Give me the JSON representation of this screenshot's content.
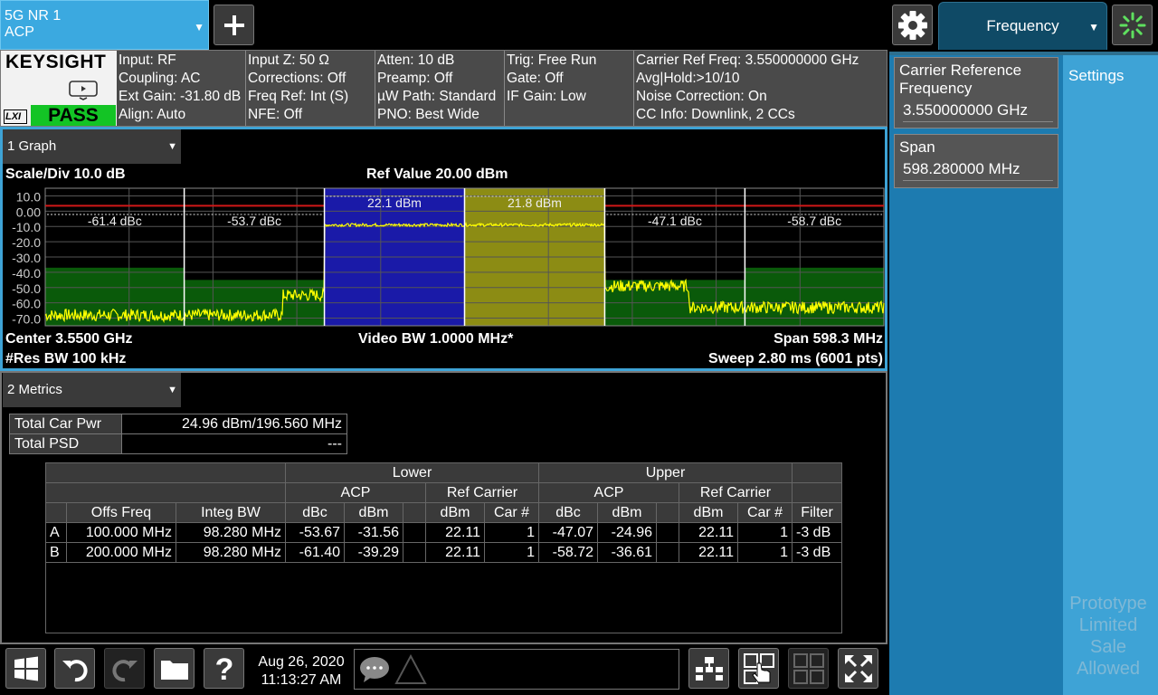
{
  "mode": {
    "line1": "5G NR 1",
    "line2": "ACP"
  },
  "menu_tab": {
    "label": "Frequency"
  },
  "settings_tab": {
    "label": "Settings"
  },
  "logo": {
    "brand": "KEYSIGHT",
    "lxi": "LXI",
    "status": "PASS"
  },
  "info": {
    "col1": [
      "Input: RF",
      "Coupling: AC",
      "Ext Gain: -31.80 dB",
      "Align: Auto"
    ],
    "col2": [
      "Input Z: 50 Ω",
      "Corrections: Off",
      "Freq Ref: Int (S)",
      "NFE: Off"
    ],
    "col3": [
      "Atten: 10 dB",
      "Preamp: Off",
      "µW Path: Standard",
      "PNO: Best Wide"
    ],
    "col4": [
      "Trig: Free Run",
      "Gate: Off",
      "IF Gain: Low"
    ],
    "col5": [
      "Carrier Ref Freq: 3.550000000 GHz",
      "Avg|Hold:>10/10",
      "Noise Correction: On",
      "CC Info: Downlink, 2 CCs"
    ]
  },
  "controls": {
    "carrier_ref": {
      "label": "Carrier Reference Frequency",
      "value": "3.550000000 GHz"
    },
    "span": {
      "label": "Span",
      "value": "598.280000 MHz"
    }
  },
  "watermark": "Prototype Limited Sale Allowed",
  "graph": {
    "window_title": "1 Graph",
    "scale_div": "Scale/Div 10.0 dB",
    "ref_value": "Ref Value 20.00 dBm",
    "center": "Center 3.5500 GHz",
    "res_bw": "#Res BW 100 kHz",
    "video_bw": "Video BW 1.0000 MHz*",
    "span": "Span 598.3 MHz",
    "sweep": "Sweep 2.80 ms (6001 pts)"
  },
  "chart_data": {
    "type": "line",
    "ylabel": "",
    "y_ticks": [
      "10.0",
      "0.00",
      "-10.0",
      "-20.0",
      "-30.0",
      "-40.0",
      "-50.0",
      "-60.0",
      "-70.0"
    ],
    "ylim": [
      -75,
      20
    ],
    "xlim_mhz": [
      3250.86,
      3849.14
    ],
    "grid": true,
    "segments": [
      {
        "label": "-61.4 dBc",
        "x_range_mhz": [
          3250.86,
          3350.0
        ],
        "kind": "offset"
      },
      {
        "label": "-53.7 dBc",
        "x_range_mhz": [
          3350.0,
          3450.0
        ],
        "kind": "offset"
      },
      {
        "label": "22.1 dBm",
        "x_range_mhz": [
          3450.0,
          3550.0
        ],
        "kind": "carrier",
        "color": "#1a1aa8"
      },
      {
        "label": "21.8 dBm",
        "x_range_mhz": [
          3550.0,
          3650.0
        ],
        "kind": "carrier",
        "color": "#8c8c14"
      },
      {
        "label": "-47.1 dBc",
        "x_range_mhz": [
          3650.0,
          3750.0
        ],
        "kind": "offset"
      },
      {
        "label": "-58.7 dBc",
        "x_range_mhz": [
          3750.0,
          3849.14
        ],
        "kind": "offset"
      }
    ],
    "limit_level_dbm": [
      {
        "x_range_mhz": [
          3250.86,
          3350.0
        ],
        "level": -37
      },
      {
        "x_range_mhz": [
          3350.0,
          3450.0
        ],
        "level": -45
      },
      {
        "x_range_mhz": [
          3650.0,
          3750.0
        ],
        "level": -45
      },
      {
        "x_range_mhz": [
          3750.0,
          3849.14
        ],
        "level": -37
      }
    ],
    "trace_level_dbm": [
      {
        "x_range_mhz": [
          3250.86,
          3420.0
        ],
        "level": -68
      },
      {
        "x_range_mhz": [
          3420.0,
          3450.0
        ],
        "level": -55
      },
      {
        "x_range_mhz": [
          3450.0,
          3650.0
        ],
        "level": -9
      },
      {
        "x_range_mhz": [
          3650.0,
          3710.0
        ],
        "level": -49
      },
      {
        "x_range_mhz": [
          3710.0,
          3849.14
        ],
        "level": -63
      }
    ],
    "ref_line_dbm": 0,
    "colors": {
      "trace": "#ffff00",
      "limit_fill": "#0a5a0a",
      "ref_line": "#d01818"
    }
  },
  "metrics": {
    "window_title": "2 Metrics",
    "total_car_pwr_label": "Total Car Pwr",
    "total_car_pwr_value": "24.96 dBm/196.560 MHz",
    "total_psd_label": "Total PSD",
    "total_psd_value": "---",
    "headers": {
      "lower": "Lower",
      "upper": "Upper",
      "acp": "ACP",
      "ref_carrier": "Ref Carrier",
      "offs_freq": "Offs Freq",
      "integ_bw": "Integ BW",
      "dbc": "dBc",
      "dbm": "dBm",
      "car_num": "Car #",
      "filter": "Filter"
    },
    "rows": [
      {
        "id": "A",
        "offs_freq": "100.000 MHz",
        "integ_bw": "98.280 MHz",
        "l_dbc": "-53.67",
        "l_dbm": "-31.56",
        "l_ref_dbm": "22.11",
        "l_car": "1",
        "u_dbc": "-47.07",
        "u_dbm": "-24.96",
        "u_ref_dbm": "22.11",
        "u_car": "1",
        "filter": "-3 dB"
      },
      {
        "id": "B",
        "offs_freq": "200.000 MHz",
        "integ_bw": "98.280 MHz",
        "l_dbc": "-61.40",
        "l_dbm": "-39.29",
        "l_ref_dbm": "22.11",
        "l_car": "1",
        "u_dbc": "-58.72",
        "u_dbm": "-36.61",
        "u_ref_dbm": "22.11",
        "u_car": "1",
        "filter": "-3 dB"
      }
    ]
  },
  "statusbar": {
    "date": "Aug 26, 2020",
    "time": "11:13:27 AM"
  },
  "icons": {
    "plus": "plus-icon",
    "gear": "gear-icon",
    "spinner": "spinner-icon",
    "windows": "windows-icon",
    "undo": "undo-icon",
    "redo": "redo-icon",
    "folder": "folder-icon",
    "help": "help-icon",
    "message": "message-icon",
    "warning": "warning-icon",
    "layout": "layout-icon",
    "touch": "touch-icon",
    "grid": "grid-icon",
    "fullscreen": "fullscreen-icon",
    "screen": "screen-icon"
  }
}
